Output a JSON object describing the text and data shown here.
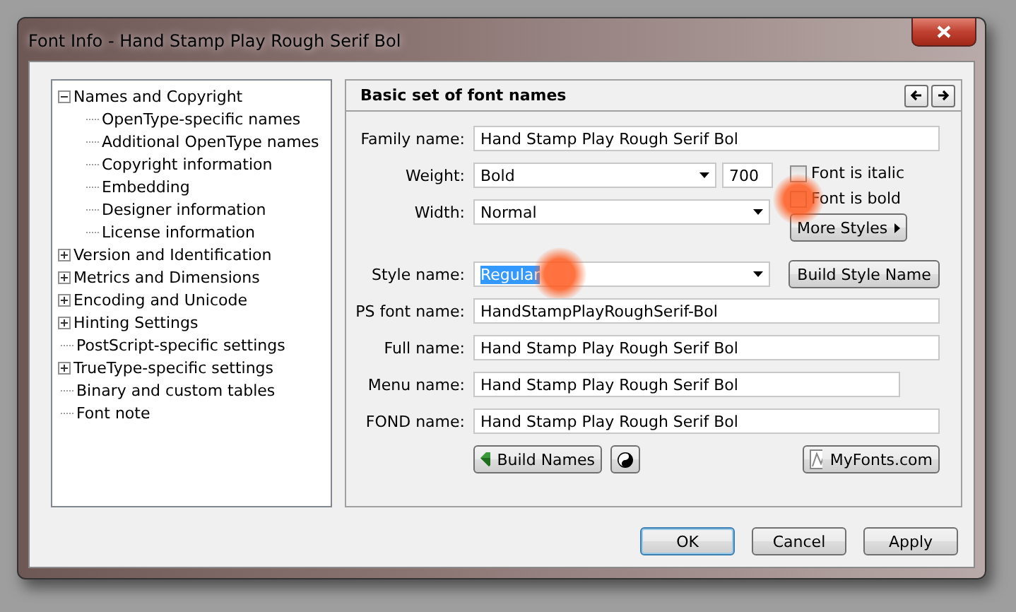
{
  "window": {
    "title": "Font Info - Hand Stamp Play Rough Serif Bol"
  },
  "tree": [
    {
      "label": "Names and Copyright",
      "kind": "group",
      "expanded": true,
      "children": [
        {
          "label": "OpenType-specific names",
          "kind": "leaf"
        },
        {
          "label": "Additional OpenType names",
          "kind": "leaf"
        },
        {
          "label": "Copyright information",
          "kind": "leaf"
        },
        {
          "label": "Embedding",
          "kind": "leaf"
        },
        {
          "label": "Designer information",
          "kind": "leaf"
        },
        {
          "label": "License information",
          "kind": "leaf"
        }
      ]
    },
    {
      "label": "Version and Identification",
      "kind": "group",
      "expanded": false
    },
    {
      "label": "Metrics and Dimensions",
      "kind": "group",
      "expanded": false
    },
    {
      "label": "Encoding and Unicode",
      "kind": "group",
      "expanded": false
    },
    {
      "label": "Hinting Settings",
      "kind": "group",
      "expanded": false
    },
    {
      "label": "PostScript-specific settings",
      "kind": "leaf"
    },
    {
      "label": "TrueType-specific settings",
      "kind": "group",
      "expanded": false
    },
    {
      "label": "Binary and custom tables",
      "kind": "leaf"
    },
    {
      "label": "Font note",
      "kind": "leaf"
    }
  ],
  "panel": {
    "title": "Basic set of font names",
    "family_name": {
      "label": "Family name:",
      "value": "Hand Stamp Play Rough Serif Bol"
    },
    "weight": {
      "label": "Weight:",
      "value": "Bold",
      "number": "700"
    },
    "width": {
      "label": "Width:",
      "value": "Normal"
    },
    "checkboxes": [
      {
        "label": "Font is italic",
        "checked": false,
        "highlight": false
      },
      {
        "label": "Font is bold",
        "checked": false,
        "highlight": true
      }
    ],
    "more_styles": "More Styles",
    "style_name": {
      "label": "Style name:",
      "value": "Regular",
      "text_selected": true,
      "highlight": true
    },
    "build_style_name": "Build Style Name",
    "names": [
      {
        "label": "PS font name:",
        "value": "HandStampPlayRoughSerif-Bol",
        "kind": "wide"
      },
      {
        "label": "Full name:",
        "value": "Hand Stamp Play Rough Serif Bol",
        "kind": "wide"
      },
      {
        "label": "Menu name:",
        "value": "Hand Stamp Play Rough Serif Bol",
        "kind": "narrow"
      },
      {
        "label": "FOND name:",
        "value": "Hand Stamp Play Rough Serif Bol",
        "kind": "wide"
      }
    ],
    "build_names": "Build Names",
    "myfonts": "MyFonts.com"
  },
  "buttons": [
    {
      "label": "OK",
      "default": true
    },
    {
      "label": "Cancel",
      "default": false
    },
    {
      "label": "Apply",
      "default": false
    }
  ]
}
